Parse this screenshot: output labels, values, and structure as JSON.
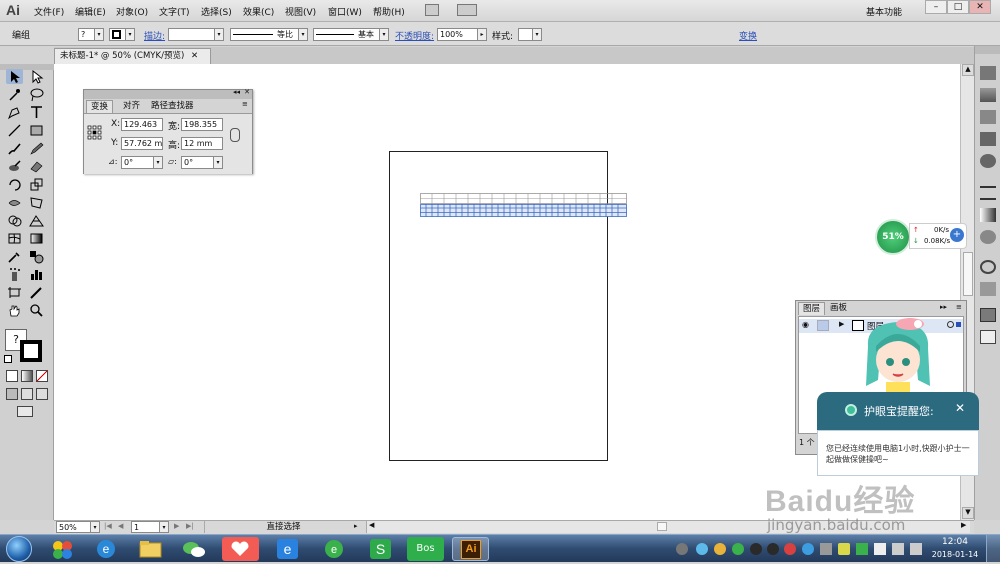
{
  "app": {
    "logo": "Ai",
    "workspace": "基本功能"
  },
  "menu": {
    "items": [
      "文件(F)",
      "编辑(E)",
      "对象(O)",
      "文字(T)",
      "选择(S)",
      "效果(C)",
      "视图(V)",
      "窗口(W)",
      "帮助(H)"
    ]
  },
  "window_controls": {
    "minimize": "–",
    "maximize": "□",
    "close": "✕"
  },
  "control_bar": {
    "selection_label": "编组",
    "fill_value": "?",
    "stroke_label": "描边:",
    "stroke_profile": "等比",
    "brush_profile": "基本",
    "opacity_label": "不透明度:",
    "opacity_value": "100%",
    "style_label": "样式:",
    "transform_link": "变换"
  },
  "document": {
    "tab_title": "未标题-1* @ 50% (CMYK/预览)",
    "tab_close": "✕"
  },
  "transform_panel": {
    "tabs": [
      "变换",
      "对齐",
      "路径查找器"
    ],
    "x_label": "X:",
    "x_value": "129.463",
    "w_label": "宽:",
    "w_value": "198.355",
    "y_label": "Y:",
    "y_value": "57.762 m",
    "h_label": "高:",
    "h_value": "12 mm",
    "rotate_value": "0°",
    "shear_value": "0°"
  },
  "layers_panel": {
    "tabs": [
      "图层",
      "画板"
    ],
    "layer_name": "图层",
    "footer_count": "1 个"
  },
  "status": {
    "zoom": "50%",
    "page": "1",
    "tool_name": "直接选择"
  },
  "net_widget": {
    "percent": "51%",
    "up": "0K/s",
    "down": "0.08K/s"
  },
  "eye_protect": {
    "title": "护眼宝提醒您:",
    "close": "✕",
    "message": "您已经连续使用电脑1小时,快跟小护士一起做做保健操吧~"
  },
  "taskbar": {
    "bos_label": "Bos",
    "ai_label": "Ai",
    "time": "12:04",
    "date": "2018-01-14"
  },
  "watermark": {
    "brand": "Baidu经验",
    "url": "jingyan.baidu.com"
  },
  "colors": {
    "accent": "#2a4fb8",
    "grid_blue": "#3a6cc6",
    "taskbar": "#2f4c71",
    "eye_green": "#2aa36b"
  }
}
